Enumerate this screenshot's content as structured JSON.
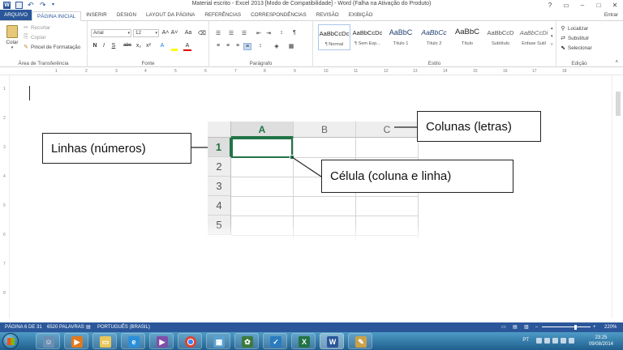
{
  "window": {
    "title": "Material escrito - Excel 2013 [Modo de Compatibilidade] - Word (Falha na Ativação do Produto)",
    "controls": [
      "?",
      "▭",
      "–",
      "□",
      "✕"
    ],
    "sign_in": "Entrar",
    "word_logo": "W"
  },
  "tabs": {
    "file": "ARQUIVO",
    "items": [
      "PÁGINA INICIAL",
      "INSERIR",
      "DESIGN",
      "LAYOUT DA PÁGINA",
      "REFERÊNCIAS",
      "CORRESPONDÊNCIAS",
      "REVISÃO",
      "EXIBIÇÃO"
    ]
  },
  "ribbon": {
    "clipboard": {
      "paste": "Colar",
      "cut": "Recortar",
      "copy": "Copiar",
      "format_painter": "Pincel de Formatação",
      "label": "Área de Transferência"
    },
    "font": {
      "name": "Arial",
      "size": "12",
      "buttons": [
        "N",
        "I",
        "S",
        "abc",
        "x₂",
        "x²",
        "A",
        "A"
      ],
      "grow": "A˄",
      "shrink": "A˅",
      "case": "Aa",
      "label": "Fonte"
    },
    "paragraph": {
      "label": "Parágrafo",
      "pilcrow": "¶"
    },
    "styles": {
      "items": [
        {
          "sample": "AaBbCcDc",
          "name": "¶ Normal"
        },
        {
          "sample": "AaBbCcDc",
          "name": "¶ Sem Esp..."
        },
        {
          "sample": "AaBbC",
          "name": "Título 1"
        },
        {
          "sample": "AaBbCc",
          "name": "Título 2"
        },
        {
          "sample": "AaBbC",
          "name": "Título"
        },
        {
          "sample": "AaBbCcD",
          "name": "Subtítulo"
        },
        {
          "sample": "AaBbCcDi",
          "name": "Ênfase Sutil"
        }
      ],
      "label": "Estilo"
    },
    "editing": {
      "find": "Localizar",
      "replace": "Substituir",
      "select": "Selecionar",
      "label": "Edição"
    }
  },
  "ruler_numbers": [
    "1",
    "2",
    "3",
    "4",
    "5",
    "6",
    "7",
    "8",
    "9",
    "10",
    "11",
    "12",
    "13",
    "14",
    "15",
    "16",
    "17",
    "18"
  ],
  "vruler_numbers": [
    "1",
    "2",
    "3",
    "4",
    "5",
    "6",
    "7",
    "8"
  ],
  "spreadsheet": {
    "columns": [
      "A",
      "B",
      "C"
    ],
    "rows": [
      "1",
      "2",
      "3",
      "4",
      "5"
    ],
    "selected_column": "A",
    "selected_row": "1"
  },
  "callouts": {
    "columns": "Colunas (letras)",
    "rows": "Linhas (números)",
    "cell": "Célula (coluna e linha)"
  },
  "statusbar": {
    "page": "PÁGINA 6 DE 31",
    "words": "6520 PALAVRAS",
    "language": "PORTUGUÊS (BRASIL)",
    "zoom": "220%"
  },
  "taskbar": {
    "lang": "PT",
    "time": "23:25",
    "date": "09/08/2014"
  },
  "colors": {
    "word_blue": "#2b579a",
    "excel_green": "#217346"
  }
}
